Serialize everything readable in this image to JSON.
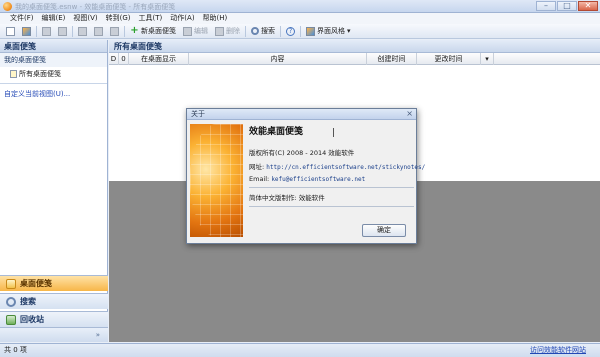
{
  "window": {
    "title": "我的桌面便笺.esnw - 效能桌面便笺 - 所有桌面便笺",
    "min": "–",
    "max": "□",
    "close": "✕"
  },
  "menu": [
    "文件(F)",
    "编辑(E)",
    "视图(V)",
    "转到(G)",
    "工具(T)",
    "动作(A)",
    "帮助(H)"
  ],
  "toolbar": {
    "new_note": "新桌面便笺",
    "edit": "编辑",
    "delete": "删除",
    "search": "搜索",
    "theme": "界面风格"
  },
  "sidebar": {
    "header": "桌面便笺",
    "group": "我的桌面便笺",
    "item": "所有桌面便笺",
    "custom_view": "自定义当前视图(U)...",
    "nav": [
      "桌面便笺",
      "搜索",
      "回收站"
    ],
    "footer_arrow": "»"
  },
  "main": {
    "header": "所有桌面便笺",
    "columns": [
      "D",
      "0",
      "在桌面显示",
      "内容",
      "创建时间",
      "更改时间"
    ]
  },
  "status": {
    "count": "共 0 项",
    "link": "访问效能软件网站"
  },
  "dialog": {
    "title": "关于",
    "close": "×",
    "product": "效能桌面便笺",
    "copyright": "版权所有(C) 2008 - 2014 效能软件",
    "website_label": "网址:",
    "website": "http://cn.efficientsoftware.net/stickynotes/",
    "email_label": "Email:",
    "email": "kefu@efficientsoftware.net",
    "localization_label": "简体中文版制作:",
    "localization": "效能软件",
    "ok": "确定"
  },
  "colors": {
    "accent_orange": "#f7b648",
    "header_blue": "#c9d7ec",
    "link_blue": "#2247b5"
  }
}
